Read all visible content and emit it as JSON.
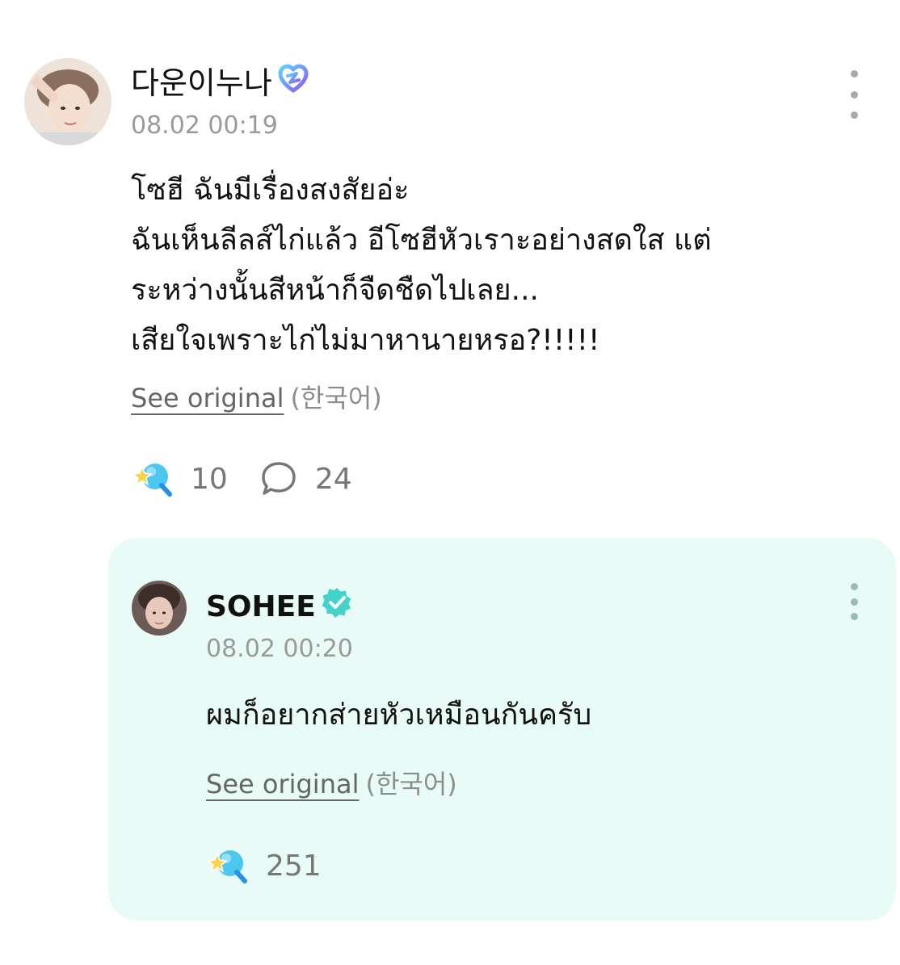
{
  "post": {
    "author": "다운이누나",
    "timestamp": "08.02 00:19",
    "lines": [
      "โซฮี ฉันมีเรื่องสงสัยอ่ะ",
      "ฉันเห็นลีลส์ไก่แล้ว อีโซฮีหัวเราะอย่างสดใส แต่",
      "ระหว่างนั้นสีหน้าก็จืดชืดไปเลย...",
      "เสียใจเพราะไก่ไม่มาหานายหรอ?!!!!!"
    ],
    "see_original": "See original",
    "language": "(한국어)",
    "likes": "10",
    "comments": "24"
  },
  "reply": {
    "author": "SOHEE",
    "timestamp": "08.02 00:20",
    "text": "ผมก็อยากส่ายหัวเหมือนกันครับ",
    "see_original": "See original",
    "language": "(한국어)",
    "likes": "251"
  },
  "icons": {
    "fan_badge": "heart-badge-icon",
    "verified_badge": "verified-check-icon",
    "more": "more-vertical-icon",
    "like": "star-wand-like-icon",
    "comment": "speech-bubble-icon"
  },
  "colors": {
    "reply_background": "#e8fbf7",
    "verified": "#43d3c8",
    "fan_badge_start": "#5fd2ff",
    "fan_badge_end": "#8b5cf6",
    "timestamp": "#9a9a9a"
  }
}
